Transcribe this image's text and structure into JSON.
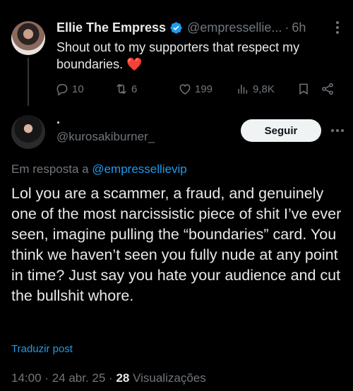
{
  "parent_tweet": {
    "name": "Ellie The Empress",
    "handle": "@empressellie...",
    "separator": "·",
    "time": "6h",
    "text": "Shout out to my supporters that respect my boundaries.",
    "emoji": "❤️",
    "actions": {
      "replies": "10",
      "reposts": "6",
      "likes": "199",
      "views": "9,8K"
    },
    "icons": [
      "verified-badge-icon",
      "more-icon",
      "reply-icon",
      "repost-icon",
      "like-icon",
      "views-icon",
      "bookmark-icon",
      "share-icon"
    ]
  },
  "reply_tweet": {
    "name": "·",
    "handle": "@kurosakiburner_",
    "follow_label": "Seguir",
    "reply_prefix": "Em resposta a",
    "reply_to": "@empressellievip",
    "text": "Lol you are a scammer, a fraud, and genuinely one of the most narcissistic piece of shit I’ve ever seen, imagine pulling the “boundaries” card. You think we haven’t seen you fully nude at any point in time? Just say you hate your audience and cut the bullshit whore.",
    "translate_label": "Traduzir post",
    "meta": {
      "time": "14:00",
      "date": "24 abr. 25",
      "sep": "·",
      "views_count": "28",
      "views_label": "Visualizações"
    }
  },
  "colors": {
    "background": "#000000",
    "text": "#e7e9ea",
    "secondary": "#71767b",
    "accent": "#1d9bf0",
    "button_bg": "#eff3f4",
    "heart": "#f0192c"
  }
}
